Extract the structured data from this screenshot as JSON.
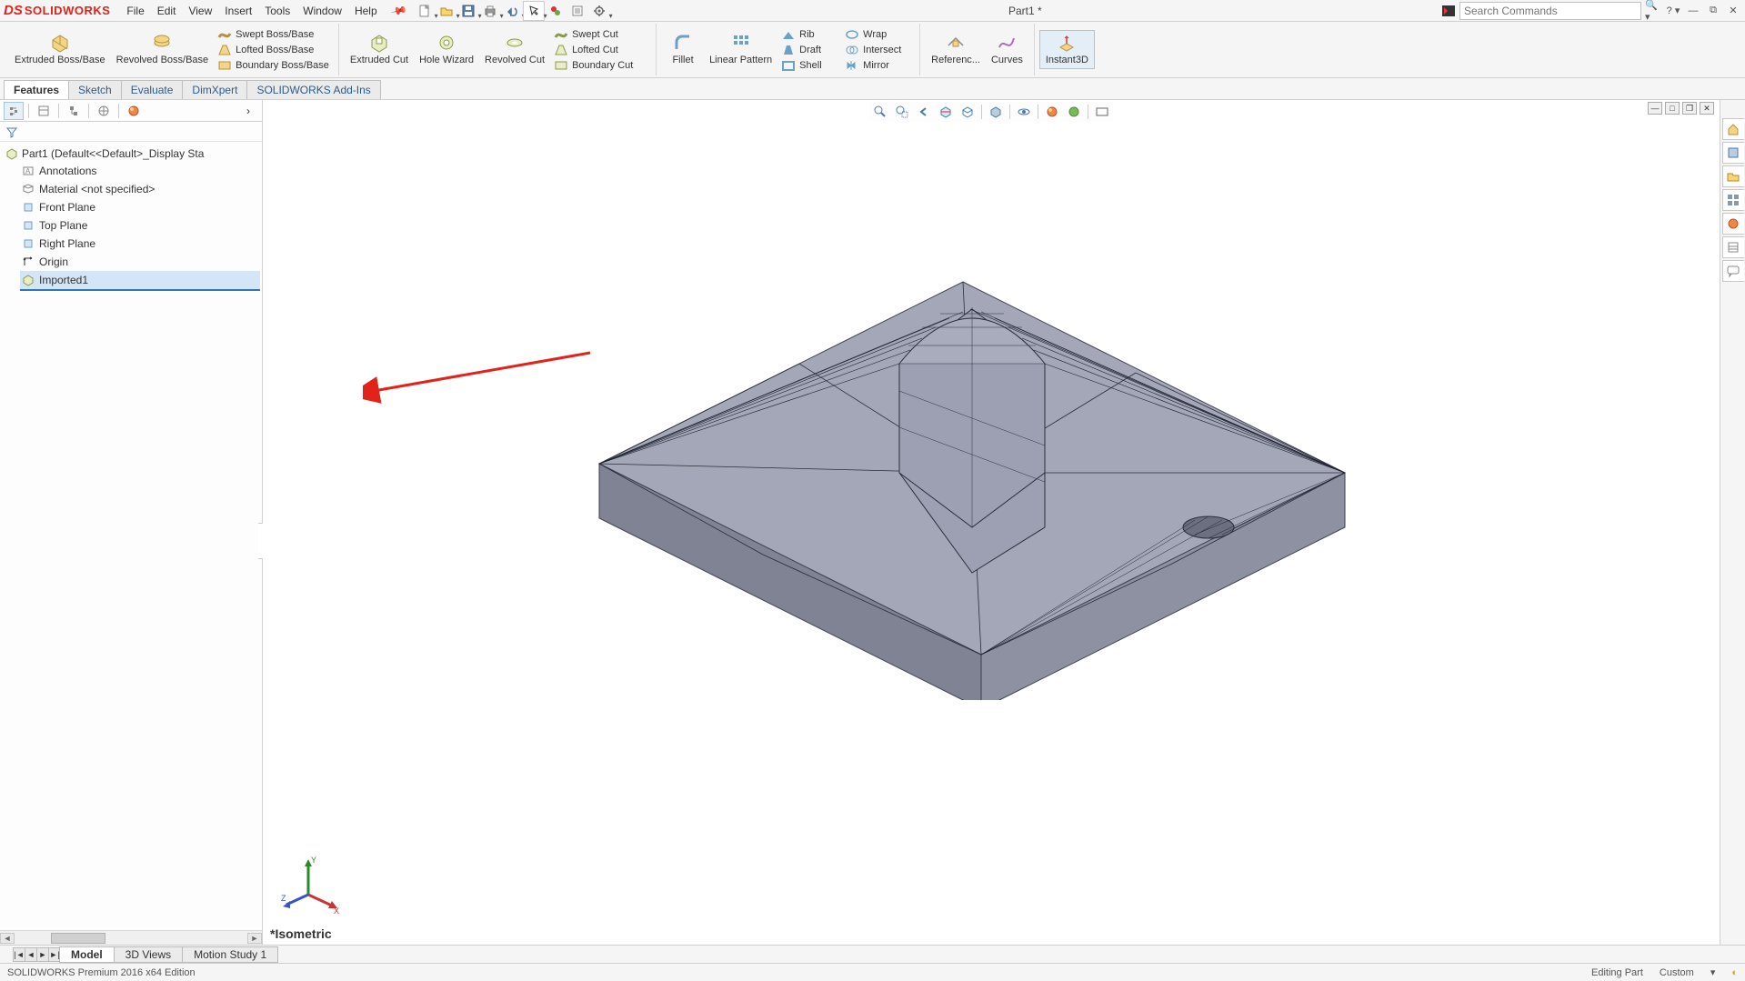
{
  "app": {
    "logo": "SOLIDWORKS",
    "title": "Part1 *"
  },
  "menu": [
    "File",
    "Edit",
    "View",
    "Insert",
    "Tools",
    "Window",
    "Help"
  ],
  "search": {
    "placeholder": "Search Commands"
  },
  "ribbon": {
    "boss": {
      "extruded": "Extruded Boss/Base",
      "revolved": "Revolved Boss/Base",
      "swept": "Swept Boss/Base",
      "lofted": "Lofted Boss/Base",
      "boundary": "Boundary Boss/Base"
    },
    "cut": {
      "extruded": "Extruded Cut",
      "hole": "Hole Wizard",
      "revolved": "Revolved Cut",
      "swept": "Swept Cut",
      "lofted": "Lofted Cut",
      "boundary": "Boundary Cut"
    },
    "pattern": {
      "fillet": "Fillet",
      "linear": "Linear Pattern",
      "rib": "Rib",
      "draft": "Draft",
      "shell": "Shell",
      "wrap": "Wrap",
      "intersect": "Intersect",
      "mirror": "Mirror"
    },
    "ref": {
      "geom": "Referenc...",
      "curves": "Curves",
      "instant": "Instant3D"
    }
  },
  "tabs": [
    "Features",
    "Sketch",
    "Evaluate",
    "DimXpert",
    "SOLIDWORKS Add-Ins"
  ],
  "tree": {
    "root": "Part1  (Default<<Default>_Display Sta",
    "items": [
      "Annotations",
      "Material <not specified>",
      "Front Plane",
      "Top Plane",
      "Right Plane",
      "Origin",
      "Imported1"
    ]
  },
  "viewport": {
    "label": "Isometric"
  },
  "bottom_tabs": [
    "Model",
    "3D Views",
    "Motion Study 1"
  ],
  "status": {
    "left": "SOLIDWORKS Premium 2016 x64 Edition",
    "mode": "Editing Part",
    "units": "Custom"
  }
}
